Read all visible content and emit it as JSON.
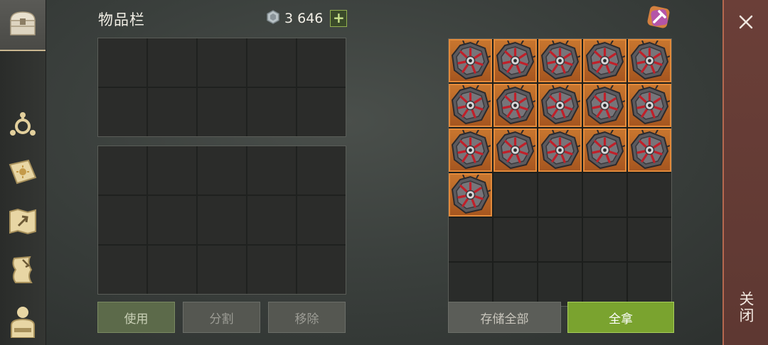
{
  "inventory": {
    "title": "物品栏",
    "currency_amount": "3 646",
    "currency_icon": "silver-coin-icon",
    "add_label": "+",
    "grid_top": {
      "rows": 2,
      "cols": 5
    },
    "grid_bottom": {
      "rows": 3,
      "cols": 5
    },
    "buttons": {
      "use": "使用",
      "split": "分割",
      "remove": "移除"
    }
  },
  "loot": {
    "item_count": 16,
    "item_icon": "spiked-shield-icon",
    "total_slots": 30,
    "buttons": {
      "store_all": "存储全部",
      "take_all": "全拿"
    }
  },
  "sidebar": {
    "icons": [
      "chest-icon",
      "crafting-icon",
      "journal-icon",
      "map-icon",
      "scroll-icon",
      "character-icon"
    ]
  },
  "close": {
    "label": "关闭"
  },
  "colors": {
    "accent_orange": "#e38a3a",
    "take_green": "#7aa32f",
    "close_red": "#6b3f38"
  }
}
